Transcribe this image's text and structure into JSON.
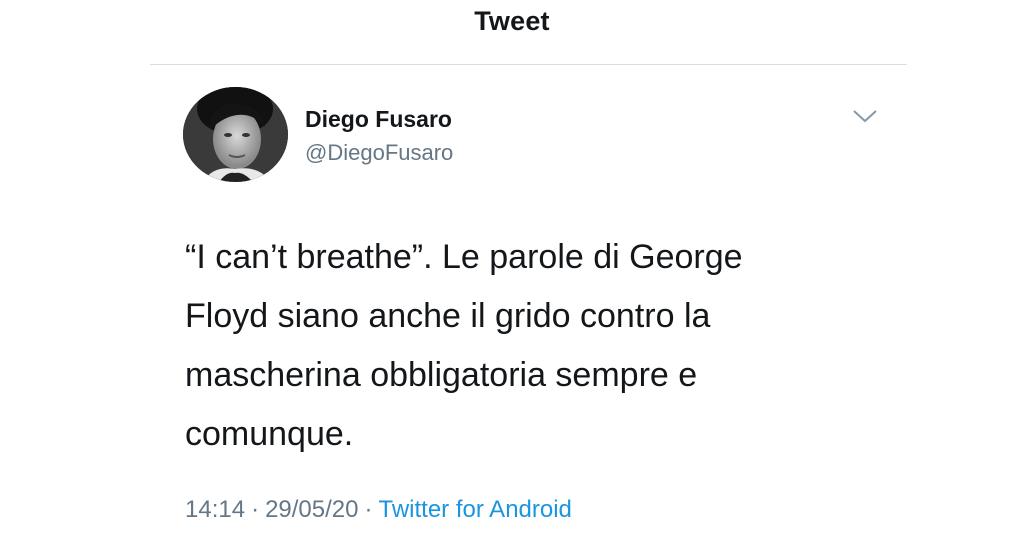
{
  "header": {
    "title": "Tweet"
  },
  "tweet": {
    "author": {
      "name": "Diego Fusaro",
      "handle": "@DiegoFusaro"
    },
    "text": "“I can’t breathe”. Le parole di George\nFloyd siano anche il grido contro la\nmascherina obbligatoria sempre e\ncomunque.",
    "time": "14:14",
    "date": "29/05/20",
    "separator": "·",
    "source": "Twitter for Android"
  },
  "icons": {
    "menu": "chevron-down-icon",
    "avatar": "avatar"
  },
  "colors": {
    "text": "#14171a",
    "secondary": "#657786",
    "link": "#1b95e0",
    "divider": "#d8dde2"
  }
}
